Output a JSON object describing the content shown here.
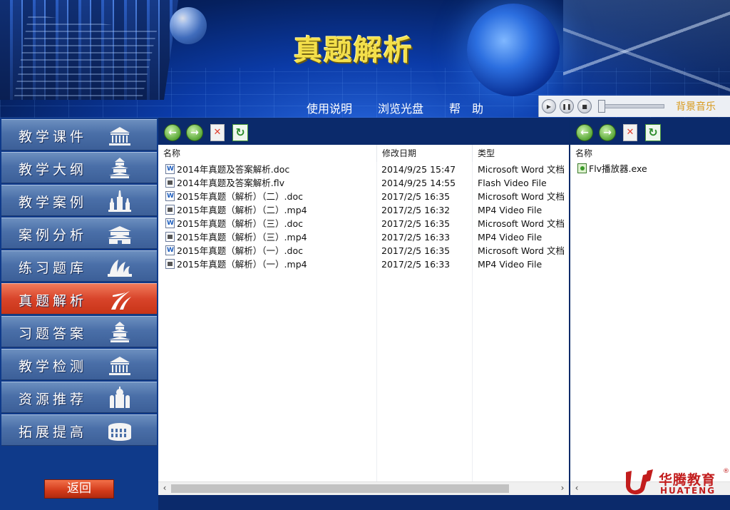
{
  "header": {
    "title": "真题解析",
    "nav": [
      "使用说明",
      "浏览光盘",
      "帮　助"
    ]
  },
  "player": {
    "play_icon": "play-icon",
    "pause_icon": "pause-icon",
    "stop_icon": "stop-icon",
    "volume": 0.0,
    "label": "背景音乐"
  },
  "sidebar": {
    "items": [
      {
        "label": "教学课件",
        "icon": "building-icon",
        "active": false
      },
      {
        "label": "教学大纲",
        "icon": "temple-icon",
        "active": false
      },
      {
        "label": "教学案例",
        "icon": "kremlin-icon",
        "active": false
      },
      {
        "label": "案例分析",
        "icon": "palace-icon",
        "active": false
      },
      {
        "label": "练习题库",
        "icon": "sydney-opera-icon",
        "active": false
      },
      {
        "label": "真题解析",
        "icon": "swoosh-icon",
        "active": true
      },
      {
        "label": "习题答案",
        "icon": "temple-icon",
        "active": false
      },
      {
        "label": "教学检测",
        "icon": "building-icon",
        "active": false
      },
      {
        "label": "资源推荐",
        "icon": "cathedral-icon",
        "active": false
      },
      {
        "label": "拓展提高",
        "icon": "colosseum-icon",
        "active": false
      }
    ],
    "back_label": "返回"
  },
  "left_pane": {
    "columns": [
      "名称",
      "修改日期",
      "类型"
    ],
    "files": [
      {
        "name": "2014年真题及答案解析.doc",
        "date": "2014/9/25 15:47",
        "type": "Microsoft Word 文档",
        "icon": "doc"
      },
      {
        "name": "2014年真题及答案解析.flv",
        "date": "2014/9/25 14:55",
        "type": "Flash Video File",
        "icon": "vid"
      },
      {
        "name": "2015年真题（解析）（二）.doc",
        "date": "2017/2/5 16:35",
        "type": "Microsoft Word 文档",
        "icon": "doc"
      },
      {
        "name": "2015年真题（解析）（二）.mp4",
        "date": "2017/2/5 16:32",
        "type": "MP4 Video File",
        "icon": "vid"
      },
      {
        "name": "2015年真题（解析）（三）.doc",
        "date": "2017/2/5 16:35",
        "type": "Microsoft Word 文档",
        "icon": "doc"
      },
      {
        "name": "2015年真题（解析）（三）.mp4",
        "date": "2017/2/5 16:33",
        "type": "MP4 Video File",
        "icon": "vid"
      },
      {
        "name": "2015年真题（解析）（一）.doc",
        "date": "2017/2/5 16:35",
        "type": "Microsoft Word 文档",
        "icon": "doc"
      },
      {
        "name": "2015年真题（解析）（一）.mp4",
        "date": "2017/2/5 16:33",
        "type": "MP4 Video File",
        "icon": "vid"
      }
    ]
  },
  "right_pane": {
    "columns": [
      "名称"
    ],
    "files": [
      {
        "name": "Flv播放器.exe",
        "icon": "exe"
      }
    ]
  },
  "toolbar": {
    "back_icon": "back-arrow-icon",
    "forward_icon": "forward-arrow-icon",
    "stop_icon": "stop-x-icon",
    "refresh_icon": "refresh-icon"
  },
  "logo": {
    "name_cn": "华腾教育",
    "name_en": "HUATENG",
    "reg": "®"
  },
  "colors": {
    "active_menu": "#d8442a",
    "menu": "#4a6fa8",
    "title": "#f4e04a",
    "music_label": "#d89a1c",
    "brand": "#c21d1d"
  }
}
